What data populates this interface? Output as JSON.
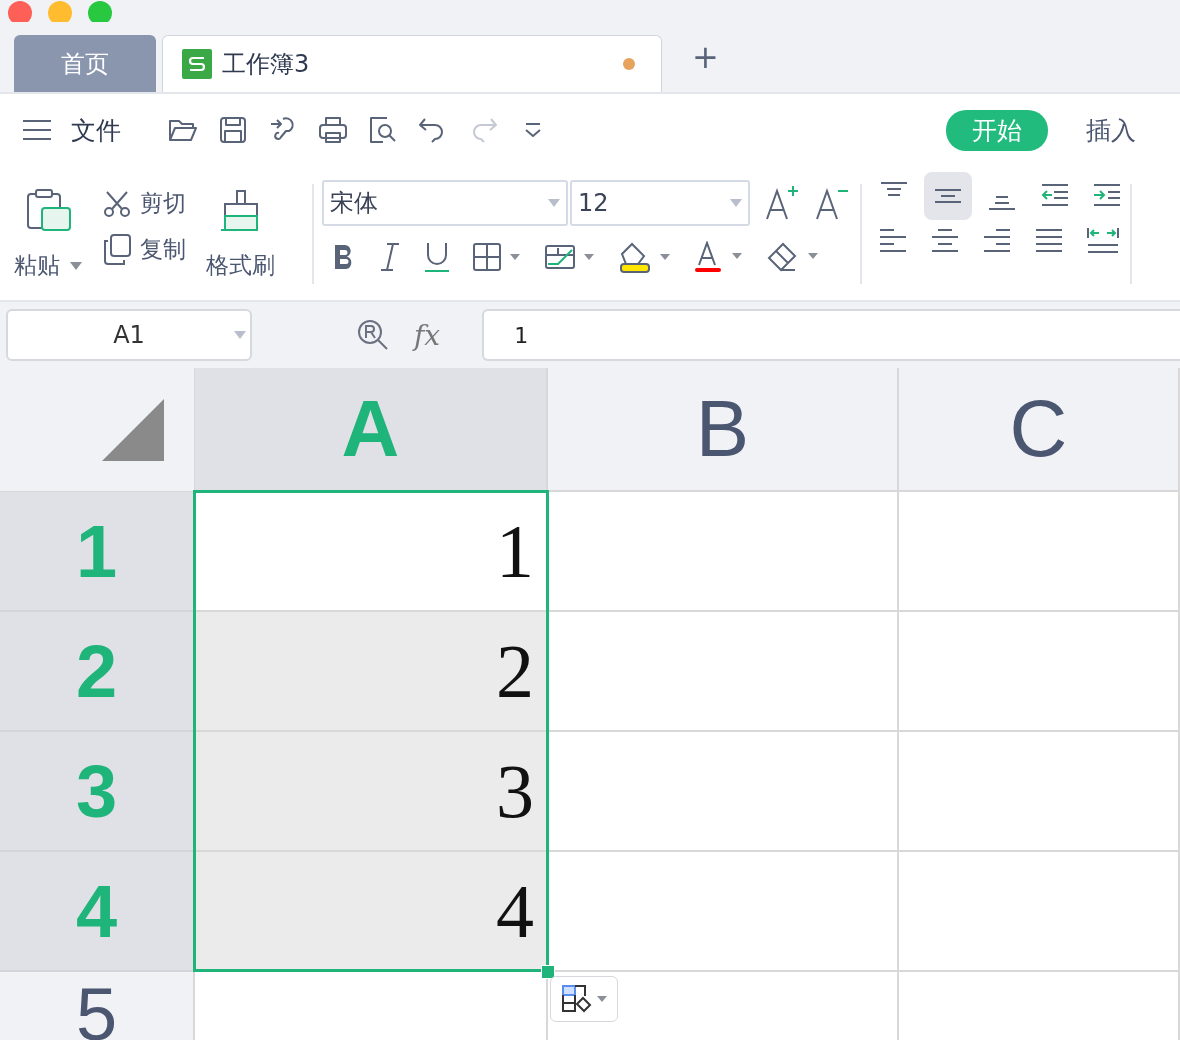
{
  "tabs": [
    {
      "label": "首页",
      "selected": false,
      "unsaved": false
    },
    {
      "label": "工作簿3",
      "selected": true,
      "unsaved": true
    }
  ],
  "new_tab": "+",
  "file_menu": "文件",
  "quick_access": [
    {
      "kind": "open",
      "disabled": false
    },
    {
      "kind": "save",
      "disabled": false
    },
    {
      "kind": "share",
      "disabled": false
    },
    {
      "kind": "print",
      "disabled": false
    },
    {
      "kind": "preview",
      "disabled": false
    },
    {
      "kind": "undo",
      "disabled": false
    },
    {
      "kind": "redo",
      "disabled": true
    },
    {
      "kind": "more",
      "disabled": false
    }
  ],
  "ribbon_tabs": [
    {
      "label": "开始",
      "selected": true
    },
    {
      "label": "插入",
      "selected": false
    }
  ],
  "clipboard": {
    "paste": "粘贴",
    "cut": "剪切",
    "copy": "复制",
    "format_painter": "格式刷"
  },
  "font": {
    "name": "宋体",
    "size": "12"
  },
  "vertical_align": [
    {
      "kind": "top",
      "selected": false
    },
    {
      "kind": "middle",
      "selected": true
    },
    {
      "kind": "bottom",
      "selected": false
    }
  ],
  "formula_bar": {
    "name_box": "A1",
    "function_label": "fx",
    "value": "1"
  },
  "columns": [
    {
      "label": "A",
      "selected": true
    },
    {
      "label": "B",
      "selected": false
    },
    {
      "label": "C",
      "selected": false
    }
  ],
  "rows": [
    {
      "label": "1",
      "selected": true,
      "active": true,
      "cells": [
        "1"
      ]
    },
    {
      "label": "2",
      "selected": true,
      "active": false,
      "cells": [
        "2"
      ]
    },
    {
      "label": "3",
      "selected": true,
      "active": false,
      "cells": [
        "3"
      ]
    },
    {
      "label": "4",
      "selected": true,
      "active": false,
      "cells": [
        "4"
      ]
    },
    {
      "label": "5",
      "selected": false,
      "cells": []
    }
  ]
}
